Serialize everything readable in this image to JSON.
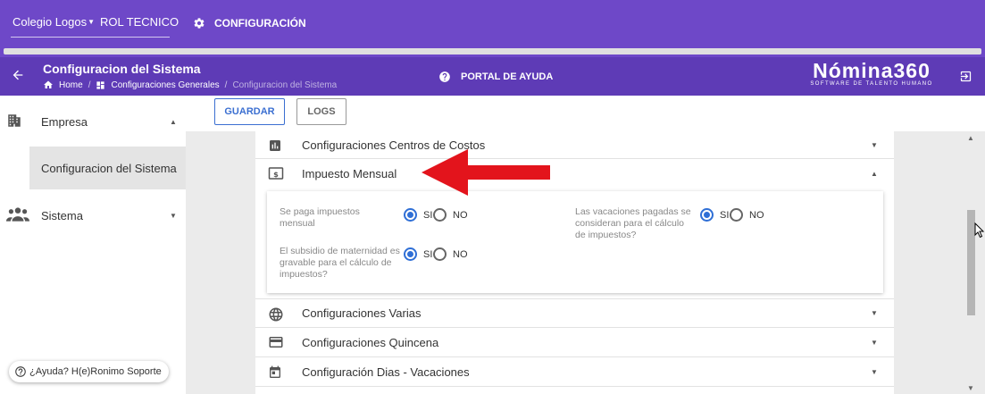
{
  "topbar": {
    "company": "Colegio Logos",
    "role": "ROL TECNICO",
    "config_label": "CONFIGURACIÓN"
  },
  "header": {
    "title": "Configuracion del Sistema",
    "breadcrumb": [
      "Home",
      "Configuraciones Generales",
      "Configuracion del Sistema"
    ],
    "help_label": "PORTAL DE AYUDA",
    "logo_main": "Nómina360",
    "logo_sub": "SOFTWARE DE TALENTO HUMANO"
  },
  "sidebar": {
    "items": [
      {
        "label": "Empresa",
        "icon": "building-icon"
      },
      {
        "label": "Configuracion del Sistema"
      },
      {
        "label": "Sistema",
        "icon": "group-icon"
      }
    ],
    "help_pill": "¿Ayuda? H(e)Ronimo Soporte"
  },
  "toolbar": {
    "save_label": "GUARDAR",
    "logs_label": "LOGS"
  },
  "sections": [
    {
      "label": "Configuraciones Centros de Costos",
      "icon": "bar-chart-icon",
      "expanded": false
    },
    {
      "label": "Impuesto Mensual",
      "icon": "money-icon",
      "expanded": true
    },
    {
      "label": "Configuraciones Varias",
      "icon": "globe-icon",
      "expanded": false
    },
    {
      "label": "Configuraciones Quincena",
      "icon": "credit-card-icon",
      "expanded": false
    },
    {
      "label": "Configuración Dias - Vacaciones",
      "icon": "calendar-icon",
      "expanded": false
    }
  ],
  "impuesto": {
    "q1": "Se paga impuestos mensual",
    "q2": "Las vacaciones pagadas se consideran para el cálculo de impuestos?",
    "q3": "El subsidio de maternidad es gravable para el cálculo de impuestos?",
    "yes": "SI",
    "no": "NO",
    "q1_value": "SI",
    "q2_value": "SI",
    "q3_value": "SI"
  },
  "colors": {
    "topbar": "#6e48c8",
    "header": "#5e3bb6",
    "primary": "#3b6fd1",
    "arrow": "#e3141c"
  }
}
